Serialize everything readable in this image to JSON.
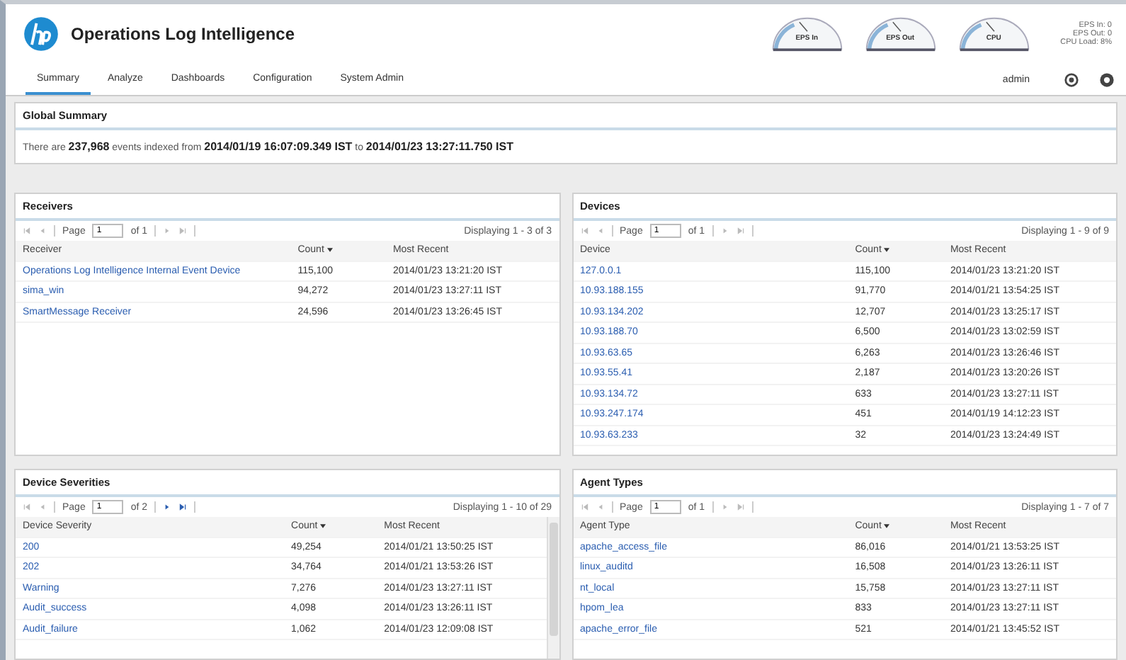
{
  "app": {
    "title": "Operations Log Intelligence"
  },
  "gauges": [
    {
      "label": "EPS In"
    },
    {
      "label": "EPS Out"
    },
    {
      "label": "CPU"
    }
  ],
  "stats": [
    "EPS In: 0",
    "EPS Out: 0",
    "CPU Load: 8%"
  ],
  "tabs": [
    {
      "label": "Summary",
      "selected": true
    },
    {
      "label": "Analyze",
      "selected": false
    },
    {
      "label": "Dashboards",
      "selected": false
    },
    {
      "label": "Configuration",
      "selected": false
    },
    {
      "label": "System Admin",
      "selected": false
    }
  ],
  "user": "admin",
  "global_summary": {
    "title": "Global Summary",
    "text": "There are **237,968** events indexed from **2014/01/19 16:07:09.349 IST** to **2014/01/23 13:27:11.750 IST**"
  },
  "panels": [
    {
      "title": "Receivers",
      "pager": {
        "label": "Page",
        "page": "1",
        "of": "of 1",
        "displaying": "Displaying 1 - 3 of 3",
        "next_enabled": false
      },
      "scrollbar": false,
      "columns": [
        {
          "label": "Receiver",
          "sorted": false
        },
        {
          "label": "Count",
          "sorted": true
        },
        {
          "label": "Most Recent",
          "sorted": false
        }
      ],
      "rows": [
        [
          "Operations Log Intelligence Internal Event Device",
          "115,100",
          "2014/01/23 13:21:20 IST"
        ],
        [
          "sima_win",
          "94,272",
          "2014/01/23 13:27:11 IST"
        ],
        [
          "SmartMessage Receiver",
          "24,596",
          "2014/01/23 13:26:45 IST"
        ]
      ]
    },
    {
      "title": "Devices",
      "pager": {
        "label": "Page",
        "page": "1",
        "of": "of 1",
        "displaying": "Displaying 1 - 9 of 9",
        "next_enabled": false
      },
      "scrollbar": false,
      "columns": [
        {
          "label": "Device",
          "sorted": false
        },
        {
          "label": "Count",
          "sorted": true
        },
        {
          "label": "Most Recent",
          "sorted": false
        }
      ],
      "rows": [
        [
          "127.0.0.1",
          "115,100",
          "2014/01/23 13:21:20 IST"
        ],
        [
          "10.93.188.155",
          "91,770",
          "2014/01/21 13:54:25 IST"
        ],
        [
          "10.93.134.202",
          "12,707",
          "2014/01/23 13:25:17 IST"
        ],
        [
          "10.93.188.70",
          "6,500",
          "2014/01/23 13:02:59 IST"
        ],
        [
          "10.93.63.65",
          "6,263",
          "2014/01/23 13:26:46 IST"
        ],
        [
          "10.93.55.41",
          "2,187",
          "2014/01/23 13:20:26 IST"
        ],
        [
          "10.93.134.72",
          "633",
          "2014/01/23 13:27:11 IST"
        ],
        [
          "10.93.247.174",
          "451",
          "2014/01/19 14:12:23 IST"
        ],
        [
          "10.93.63.233",
          "32",
          "2014/01/23 13:24:49 IST"
        ]
      ]
    },
    {
      "title": "Device Severities",
      "pager": {
        "label": "Page",
        "page": "1",
        "of": "of 2",
        "displaying": "Displaying 1 - 10 of 29",
        "next_enabled": true
      },
      "scrollbar": true,
      "columns": [
        {
          "label": "Device Severity",
          "sorted": false
        },
        {
          "label": "Count",
          "sorted": true
        },
        {
          "label": "Most Recent",
          "sorted": false
        }
      ],
      "rows": [
        [
          "200",
          "49,254",
          "2014/01/21 13:50:25 IST"
        ],
        [
          "202",
          "34,764",
          "2014/01/21 13:53:26 IST"
        ],
        [
          "Warning",
          "7,276",
          "2014/01/23 13:27:11 IST"
        ],
        [
          "Audit_success",
          "4,098",
          "2014/01/23 13:26:11 IST"
        ],
        [
          "Audit_failure",
          "1,062",
          "2014/01/23 12:09:08 IST"
        ]
      ]
    },
    {
      "title": "Agent Types",
      "pager": {
        "label": "Page",
        "page": "1",
        "of": "of 1",
        "displaying": "Displaying 1 - 7 of 7",
        "next_enabled": false
      },
      "scrollbar": false,
      "columns": [
        {
          "label": "Agent Type",
          "sorted": false
        },
        {
          "label": "Count",
          "sorted": true
        },
        {
          "label": "Most Recent",
          "sorted": false
        }
      ],
      "rows": [
        [
          "apache_access_file",
          "86,016",
          "2014/01/21 13:53:25 IST"
        ],
        [
          "linux_auditd",
          "16,508",
          "2014/01/23 13:26:11 IST"
        ],
        [
          "nt_local",
          "15,758",
          "2014/01/23 13:27:11 IST"
        ],
        [
          "hpom_lea",
          "833",
          "2014/01/23 13:27:11 IST"
        ],
        [
          "apache_error_file",
          "521",
          "2014/01/21 13:45:52 IST"
        ]
      ]
    }
  ]
}
